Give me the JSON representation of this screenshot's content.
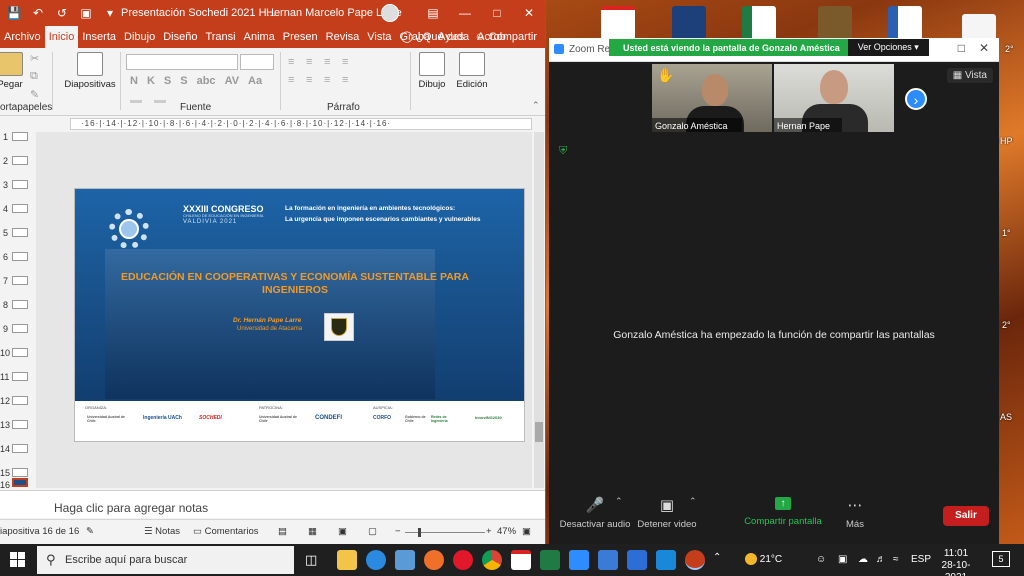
{
  "powerpoint": {
    "title": "Presentación Sochedi 2021 H...",
    "user_name": "Hernan Marcelo Pape Larre",
    "tabs": [
      "Archivo",
      "Inicio",
      "Inserta",
      "Dibujo",
      "Diseño",
      "Transi",
      "Anima",
      "Presen",
      "Revisa",
      "Vista",
      "Graba",
      "Ayuda",
      "Acrob"
    ],
    "tab_search": "¿Qué des",
    "share_label": "Compartir",
    "ribbon": {
      "paste_label": "Pegar",
      "clipboard_label": "ortapapeles",
      "slides_label": "Diapositivas",
      "font_group": "Fuente",
      "paragraph_group": "Párrafo",
      "draw_label": "Dibujo",
      "edit_label": "Edición",
      "format_buttons": [
        "N",
        "K",
        "S",
        "S",
        "abc",
        "AV",
        "Aa",
        "A"
      ]
    },
    "ruler_text": "·16·|·14·|·12·|·10·|·8·|·6·|·4·|·2·|·0·|·2·|·4·|·6·|·8·|·10·|·12·|·14·|·16·",
    "thumbnail_numbers": [
      "1",
      "2",
      "3",
      "4",
      "5",
      "6",
      "7",
      "8",
      "9",
      "10",
      "11",
      "12",
      "13",
      "14",
      "15",
      "16"
    ],
    "slide": {
      "congress_number": "XXXIII CONGRESO",
      "congress_sub": "CHILENO DE EDUCACIÓN EN INGENIERÍA",
      "congress_city": "VALDIVIA 2021",
      "theme_line1": "La formación en ingeniería en ambientes tecnológicos:",
      "theme_line2": "La urgencia  que imponen escenarios cambiantes y vulnerables",
      "headline_line1": "EDUCACIÓN EN COOPERATIVAS Y ECONOMÍA SUSTENTABLE PARA",
      "headline_line2": "INGENIEROS",
      "author": "Dr. Hernán Pape Larre",
      "university": "Universidad de Atacama",
      "organiza_label": "ORGANIZA:",
      "patrocina_label": "PATROCINA:",
      "auspicia_label": "AUSPICIA:",
      "sponsor_logos": [
        "Universidad Austral de Chile",
        "Ingeniería UACh",
        "SOCHEDI",
        "Universidad Austral de Chile",
        "CONDEFI",
        "CORFO",
        "Gobierno de Chile",
        "Redes de Ingeniería",
        "InnovING2030"
      ]
    },
    "notes_placeholder": "Haga clic para agregar notas",
    "status": {
      "slide_counter": "iapositiva 16 de 16",
      "notes_label": "Notas",
      "comments_label": "Comentarios",
      "zoom_level": "47%"
    }
  },
  "desktop": {
    "right_edge_labels": [
      "2°",
      "HP",
      "1°",
      "2°",
      "AS"
    ]
  },
  "zoom": {
    "window_title": "Zoom Re",
    "share_banner": "Usted está viendo la pantalla de Gonzalo Améstica",
    "view_options": "Ver Opciones",
    "vista_label": "Vista",
    "participants": [
      {
        "name": "Gonzalo Améstica"
      },
      {
        "name": "Hernan Pape"
      }
    ],
    "message": "Gonzalo Améstica ha empezado la función de compartir las pantallas",
    "toolbar": {
      "mute": "Desactivar audio",
      "video": "Detener video",
      "share": "Compartir pantalla",
      "more": "Más",
      "leave": "Salir"
    }
  },
  "taskbar": {
    "search_placeholder": "Escribe aquí para buscar",
    "temperature": "21°C",
    "language": "ESP",
    "time": "11:01",
    "date": "28-10-2021",
    "notification_count": "5"
  }
}
